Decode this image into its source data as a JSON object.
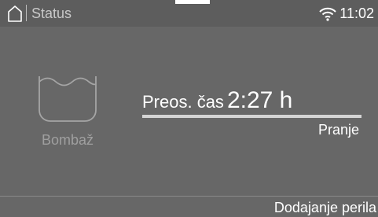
{
  "status_bar": {
    "title": "Status",
    "time": "11:02",
    "icons": [
      "home-icon",
      "wifi-icon"
    ]
  },
  "program": {
    "name": "Bombaž",
    "icon": "wash-tub-icon"
  },
  "remaining": {
    "label": "Preos. čas",
    "value": "2:27 h",
    "progress_fraction": 0.0
  },
  "phase": "Pranje",
  "bottom_bar": {
    "action_label": "Dodajanje perila"
  },
  "colors": {
    "background": "#676767",
    "status_bar": "#5d5d5d",
    "dim_text": "#9f9f9f"
  }
}
